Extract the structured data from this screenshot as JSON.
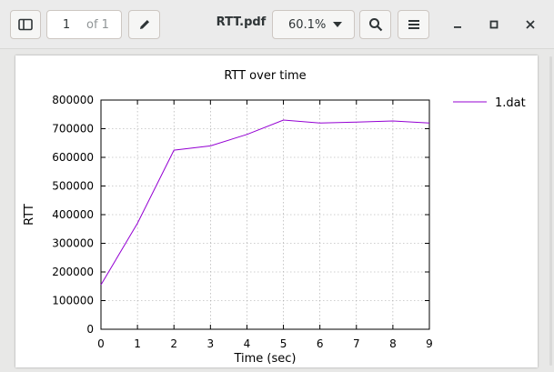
{
  "toolbar": {
    "page_current": "1",
    "page_total_label": "of 1",
    "document_title": "RTT.pdf",
    "zoom_level": "60.1%"
  },
  "icons": {
    "sidebar": "sidebar-toggle-icon",
    "annotate": "pencil-icon",
    "zoom_menu": "chevron-down-icon",
    "search": "search-icon",
    "menu": "hamburger-menu-icon",
    "minimize": "minimize-icon",
    "maximize": "maximize-icon",
    "close": "close-icon"
  },
  "colors": {
    "series_line": "#9400d3",
    "grid": "#a0a0a0"
  },
  "chart_data": {
    "type": "line",
    "title": "RTT over time",
    "xlabel": "Time (sec)",
    "ylabel": "RTT",
    "xlim": [
      0,
      9
    ],
    "ylim": [
      0,
      800000
    ],
    "x_ticks": [
      "0",
      "1",
      "2",
      "3",
      "4",
      "5",
      "6",
      "7",
      "8",
      "9"
    ],
    "y_ticks": [
      "0",
      "100000",
      "200000",
      "300000",
      "400000",
      "500000",
      "600000",
      "700000",
      "800000"
    ],
    "grid": true,
    "legend_position": "outside-right",
    "series": [
      {
        "name": "1.dat",
        "x": [
          0,
          1,
          2,
          3,
          4,
          5,
          6,
          7,
          8,
          9
        ],
        "y": [
          155000,
          370000,
          625000,
          640000,
          680000,
          730000,
          720000,
          723000,
          727000,
          720000
        ]
      }
    ]
  }
}
